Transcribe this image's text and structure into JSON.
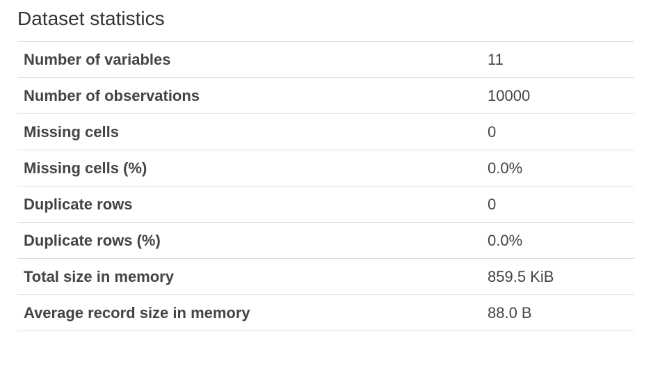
{
  "section": {
    "title": "Dataset statistics"
  },
  "stats": [
    {
      "label": "Number of variables",
      "value": "11"
    },
    {
      "label": "Number of observations",
      "value": "10000"
    },
    {
      "label": "Missing cells",
      "value": "0"
    },
    {
      "label": "Missing cells (%)",
      "value": "0.0%"
    },
    {
      "label": "Duplicate rows",
      "value": "0"
    },
    {
      "label": "Duplicate rows (%)",
      "value": "0.0%"
    },
    {
      "label": "Total size in memory",
      "value": "859.5 KiB"
    },
    {
      "label": "Average record size in memory",
      "value": "88.0 B"
    }
  ]
}
